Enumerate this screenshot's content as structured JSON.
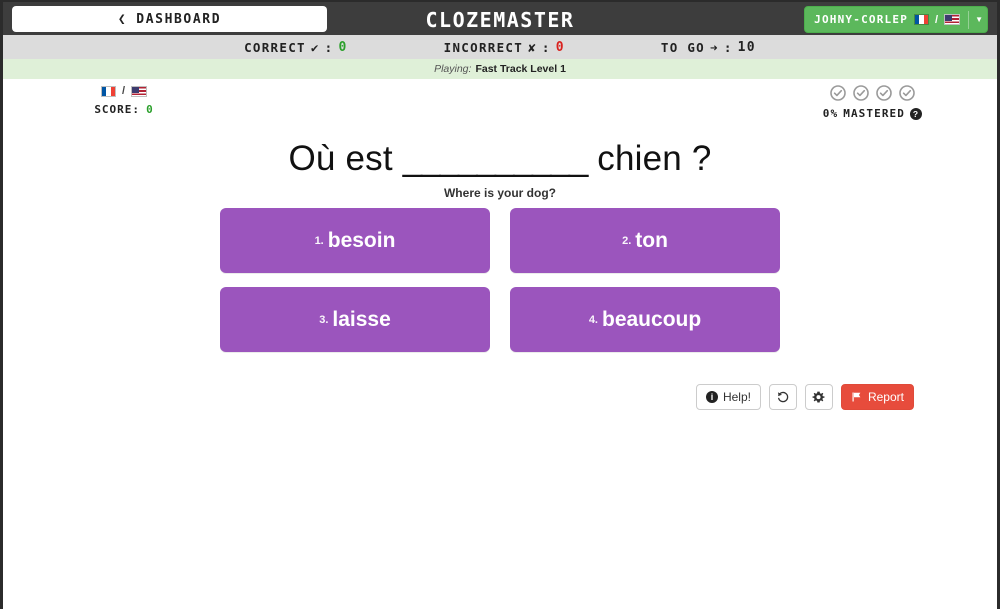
{
  "navbar": {
    "dashboard_label": "DASHBOARD",
    "dashboard_caret": "❮",
    "brand": "CLOZEMASTER",
    "user_name": "JOHNY-CORLEP",
    "user_caret": "▼",
    "flag_separator": "/",
    "source_flag": "france-flag-icon",
    "target_flag": "usa-flag-icon"
  },
  "stats": {
    "correct_label": "CORRECT",
    "correct_icon": "✔",
    "correct_sep": ":",
    "correct_value": "0",
    "incorrect_label": "INCORRECT",
    "incorrect_icon": "✘",
    "incorrect_sep": ":",
    "incorrect_value": "0",
    "togo_label": "TO GO",
    "togo_icon": "➜",
    "togo_sep": ":",
    "togo_value": "10"
  },
  "playing": {
    "prefix": "Playing:",
    "collection": "Fast Track Level 1"
  },
  "score": {
    "label": "SCORE:",
    "value": "0",
    "separator": "/"
  },
  "mastered": {
    "percent_label": "0%",
    "label": "MASTERED",
    "help_badge": "?",
    "check_count": 4
  },
  "question": {
    "before": "Où est",
    "blank": "__________",
    "after": "chien ?",
    "translation": "Where is your dog?"
  },
  "choices": [
    {
      "number": "1.",
      "text": "besoin"
    },
    {
      "number": "2.",
      "text": "ton"
    },
    {
      "number": "3.",
      "text": "laisse"
    },
    {
      "number": "4.",
      "text": "beaucoup"
    }
  ],
  "toolbar": {
    "help_label": "Help!",
    "help_icon": "info-icon",
    "history_icon": "undo-arrow-icon",
    "settings_icon": "gear-icon",
    "report_label": "Report",
    "report_icon": "flag-icon"
  },
  "colors": {
    "navbar_bg": "#3d3d3d",
    "stats_bg": "#dcdcdc",
    "playing_bg": "#dff0d8",
    "choice_purple": "#9b55bd",
    "report_red": "#e74c3c",
    "user_green": "#5cb85c",
    "correct_green": "#2ca02c",
    "incorrect_red": "#d9231f"
  }
}
